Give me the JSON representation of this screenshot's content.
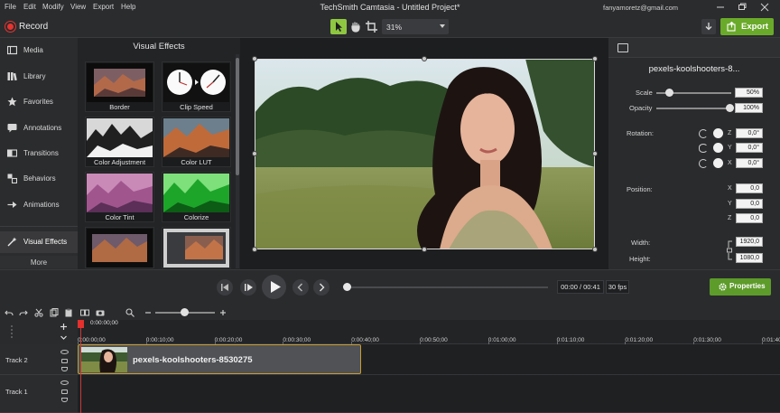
{
  "menu": {
    "items": [
      "File",
      "Edit",
      "Modify",
      "View",
      "Export",
      "Help"
    ],
    "title": "TechSmith Camtasia - Untitled Project*",
    "account": "fanyamoretz@gmail.com"
  },
  "toolbar": {
    "record_label": "Record",
    "zoom": "31%",
    "export_label": "Export"
  },
  "sidebar": {
    "items": [
      {
        "label": "Media",
        "icon": "media-icon"
      },
      {
        "label": "Library",
        "icon": "library-icon"
      },
      {
        "label": "Favorites",
        "icon": "star-icon"
      },
      {
        "label": "Annotations",
        "icon": "annotations-icon"
      },
      {
        "label": "Transitions",
        "icon": "transitions-icon"
      },
      {
        "label": "Behaviors",
        "icon": "behaviors-icon"
      },
      {
        "label": "Animations",
        "icon": "animations-icon"
      },
      {
        "label": "Visual Effects",
        "icon": "visual-effects-icon"
      }
    ],
    "more_label": "More"
  },
  "effects": {
    "title": "Visual Effects",
    "items": [
      {
        "label": "Border"
      },
      {
        "label": "Clip Speed"
      },
      {
        "label": "Color Adjustment"
      },
      {
        "label": "Color LUT"
      },
      {
        "label": "Color Tint"
      },
      {
        "label": "Colorize"
      }
    ]
  },
  "properties": {
    "clip_name": "pexels-koolshooters-8...",
    "scale_label": "Scale",
    "scale_value": "50%",
    "scale_level": 0.5,
    "opacity_label": "Opacity",
    "opacity_value": "100%",
    "opacity_level": 1.0,
    "rotation_label": "Rotation:",
    "rotation": {
      "z": "0,0°",
      "y": "0,0°",
      "x": "0,0°"
    },
    "position_label": "Position:",
    "position": {
      "x": "0,0",
      "y": "0,0",
      "z": "0,0"
    },
    "width_label": "Width:",
    "width_value": "1920,0",
    "height_label": "Height:",
    "height_value": "1080,0",
    "axis": {
      "x": "X",
      "y": "Y",
      "z": "Z"
    }
  },
  "playback": {
    "timecode": "00:00 / 00:41",
    "fps": "30 fps",
    "properties_label": "Properties",
    "progress": 0.0
  },
  "timeline": {
    "playhead_time": "0:00:00;00",
    "ticks": [
      "0:00:00;00",
      "0:00:10;00",
      "0:00:20;00",
      "0:00:30;00",
      "0:00:40;00",
      "0:00:50;00",
      "0:01:00;00",
      "0:01:10;00",
      "0:01:20;00",
      "0:01:30;00",
      "0:01:40"
    ],
    "tracks": [
      {
        "name": "Track 2"
      },
      {
        "name": "Track 1"
      }
    ],
    "clip_label": "pexels-koolshooters-8530275"
  },
  "colors": {
    "accent_green": "#6aaa2a",
    "record_red": "#e8332f",
    "clip_border": "#c79d33"
  }
}
